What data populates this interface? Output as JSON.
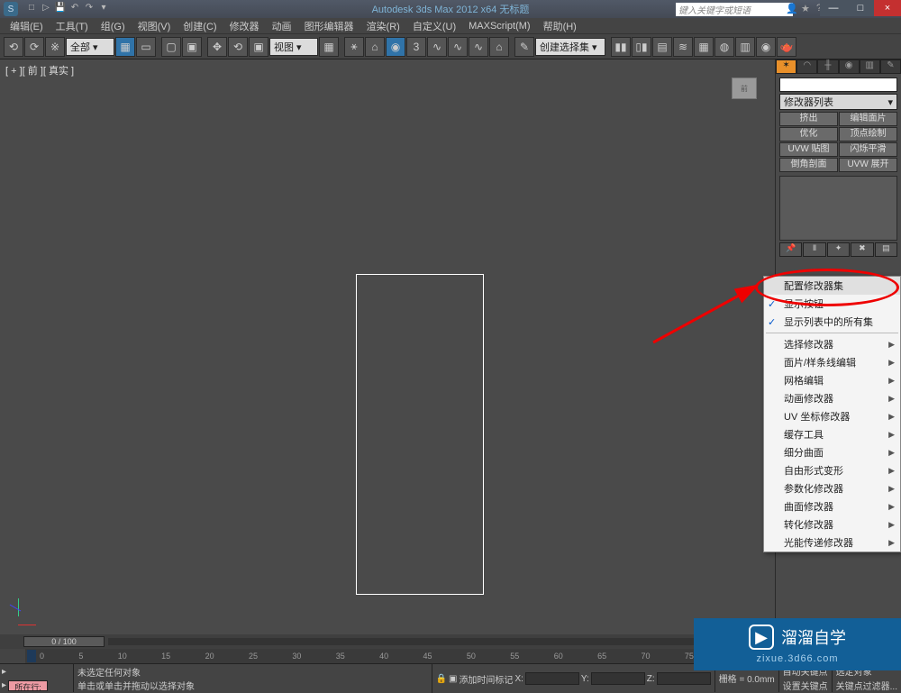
{
  "titlebar": {
    "appicon_text": "S",
    "title": "Autodesk 3ds Max  2012 x64    无标题",
    "search_placeholder": "键入关键字或短语",
    "min": "—",
    "max": "□",
    "close": "×"
  },
  "menubar": {
    "items": [
      "编辑(E)",
      "工具(T)",
      "组(G)",
      "视图(V)",
      "创建(C)",
      "修改器",
      "动画",
      "图形编辑器",
      "渲染(R)",
      "自定义(U)",
      "MAXScript(M)",
      "帮助(H)"
    ]
  },
  "toolbar": {
    "sel_all": "全部 ▾",
    "sel_view": "视图 ▾",
    "sel_create": "创建选择集 ▾"
  },
  "viewport": {
    "label": "[ + ][ 前 ][ 真实 ]",
    "cube": "前"
  },
  "rightpanel": {
    "dropdown": "修改器列表",
    "grid": [
      [
        "挤出",
        "编辑面片"
      ],
      [
        "优化",
        "顶点绘制"
      ],
      [
        "UVW 贴图",
        "闪烁平滑"
      ],
      [
        "倒角剖面",
        "UVW 展开"
      ]
    ]
  },
  "ctxmenu": {
    "items": [
      {
        "label": "配置修改器集",
        "type": "plain",
        "hover": true
      },
      {
        "label": "显示按钮",
        "type": "check"
      },
      {
        "label": "显示列表中的所有集",
        "type": "check"
      },
      {
        "type": "sep"
      },
      {
        "label": "选择修改器",
        "type": "sub"
      },
      {
        "label": "面片/样条线编辑",
        "type": "sub"
      },
      {
        "label": "网格编辑",
        "type": "sub"
      },
      {
        "label": "动画修改器",
        "type": "sub"
      },
      {
        "label": "UV 坐标修改器",
        "type": "sub"
      },
      {
        "label": "缓存工具",
        "type": "sub"
      },
      {
        "label": "细分曲面",
        "type": "sub"
      },
      {
        "label": "自由形式变形",
        "type": "sub"
      },
      {
        "label": "参数化修改器",
        "type": "sub"
      },
      {
        "label": "曲面修改器",
        "type": "sub"
      },
      {
        "label": "转化修改器",
        "type": "sub"
      },
      {
        "label": "光能传递修改器",
        "type": "sub"
      }
    ]
  },
  "timeline": {
    "slider": "0 / 100",
    "ticks": [
      "0",
      "5",
      "10",
      "15",
      "20",
      "25",
      "30",
      "35",
      "40",
      "45",
      "50",
      "55",
      "60",
      "65",
      "70",
      "75"
    ]
  },
  "status": {
    "row1_leftbtn": "所在行:",
    "none_selected": "未选定任何对象",
    "hint": "单击或单击并拖动以选择对象",
    "add_marker": "添加时间标记",
    "lock_icon": "🔒",
    "x": "X:",
    "y": "Y:",
    "z": "Z:",
    "grid": "栅格 = 0.0mm",
    "autokey": "自动关键点",
    "selset": "选定对象",
    "setkey": "设置关键点",
    "keyfilter": "关键点过滤器..."
  },
  "watermark": {
    "text": "溜溜自学",
    "url": "zixue.3d66.com"
  }
}
